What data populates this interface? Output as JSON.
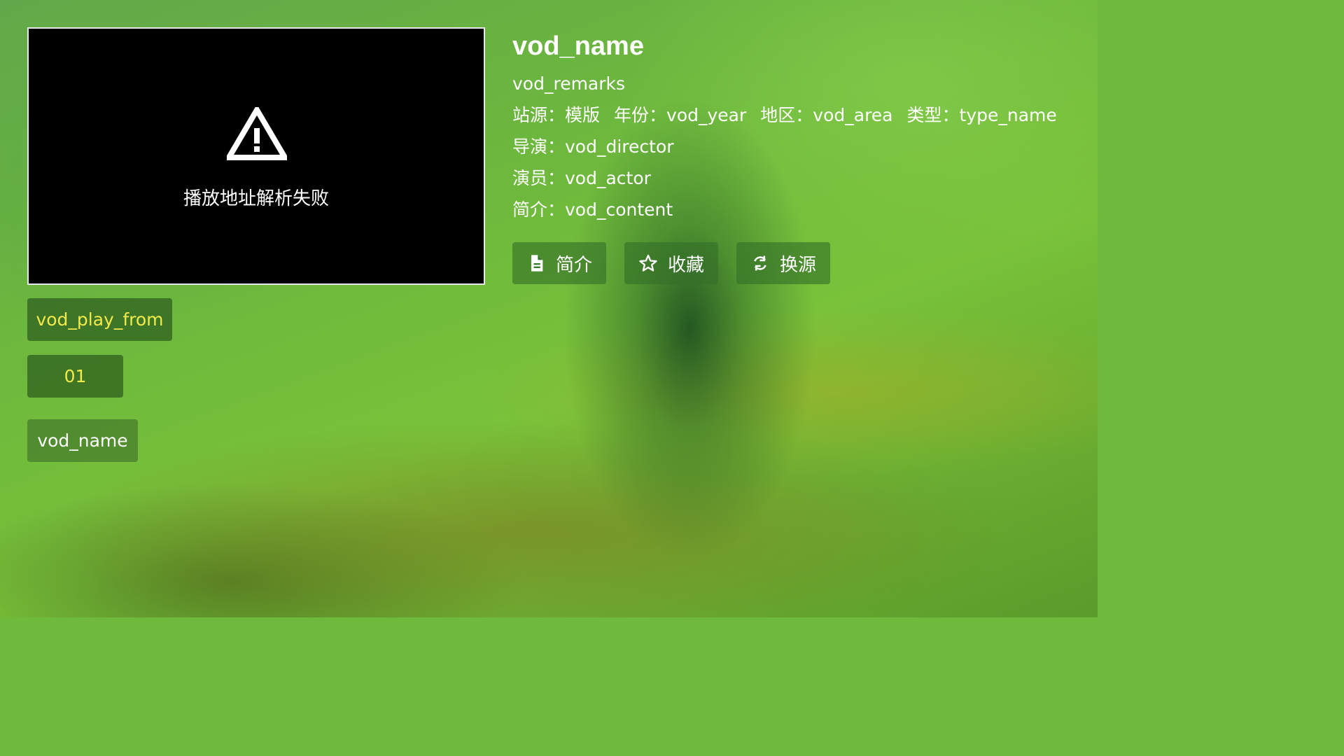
{
  "player": {
    "error_message": "播放地址解析失败",
    "error_icon": "warning-icon"
  },
  "info": {
    "title": "vod_name",
    "remarks": "vod_remarks",
    "site_label": "站源：",
    "site_value": "模版",
    "year_label": "年份：",
    "year_value": "vod_year",
    "area_label": "地区：",
    "area_value": "vod_area",
    "type_label": "类型：",
    "type_value": "type_name",
    "director_label": "导演：",
    "director_value": "vod_director",
    "actor_label": "演员：",
    "actor_value": "vod_actor",
    "content_label": "简介：",
    "content_value": "vod_content"
  },
  "actions": {
    "intro_label": "简介",
    "intro_icon": "document-icon",
    "favorite_label": "收藏",
    "favorite_icon": "star-outline-icon",
    "source_label": "换源",
    "source_icon": "refresh-icon"
  },
  "playlist": {
    "source_name": "vod_play_from",
    "episode": "01",
    "related_name": "vod_name"
  },
  "colors": {
    "selected_text": "#f2e94a",
    "chip_bg": "#2c5c1e",
    "button_bg": "#347028"
  }
}
